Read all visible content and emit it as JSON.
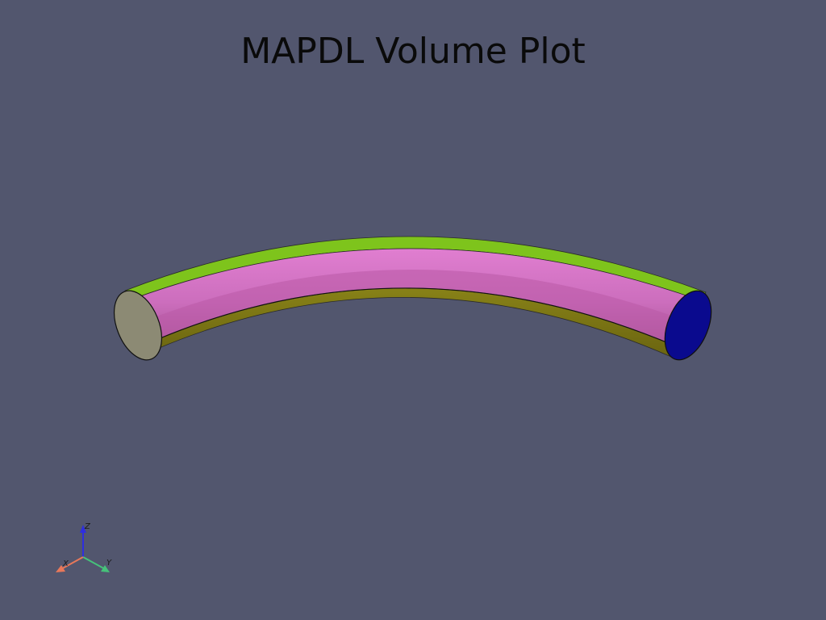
{
  "title": "MAPDL Volume Plot",
  "orientation_widget": {
    "x_label": "X",
    "y_label": "Y",
    "z_label": "Z",
    "colors": {
      "x": "#e8785a",
      "y": "#46c27a",
      "z": "#2e2ee0"
    }
  },
  "colors": {
    "background": "#52566e",
    "top_face": "#d872c6",
    "top_face_shade": "#b95aa6",
    "outer_rim": "#7ec41c",
    "inner_side": "#7b7614",
    "end_cap_left": "#8c8a74",
    "end_cap_right": "#0a0a8e"
  }
}
